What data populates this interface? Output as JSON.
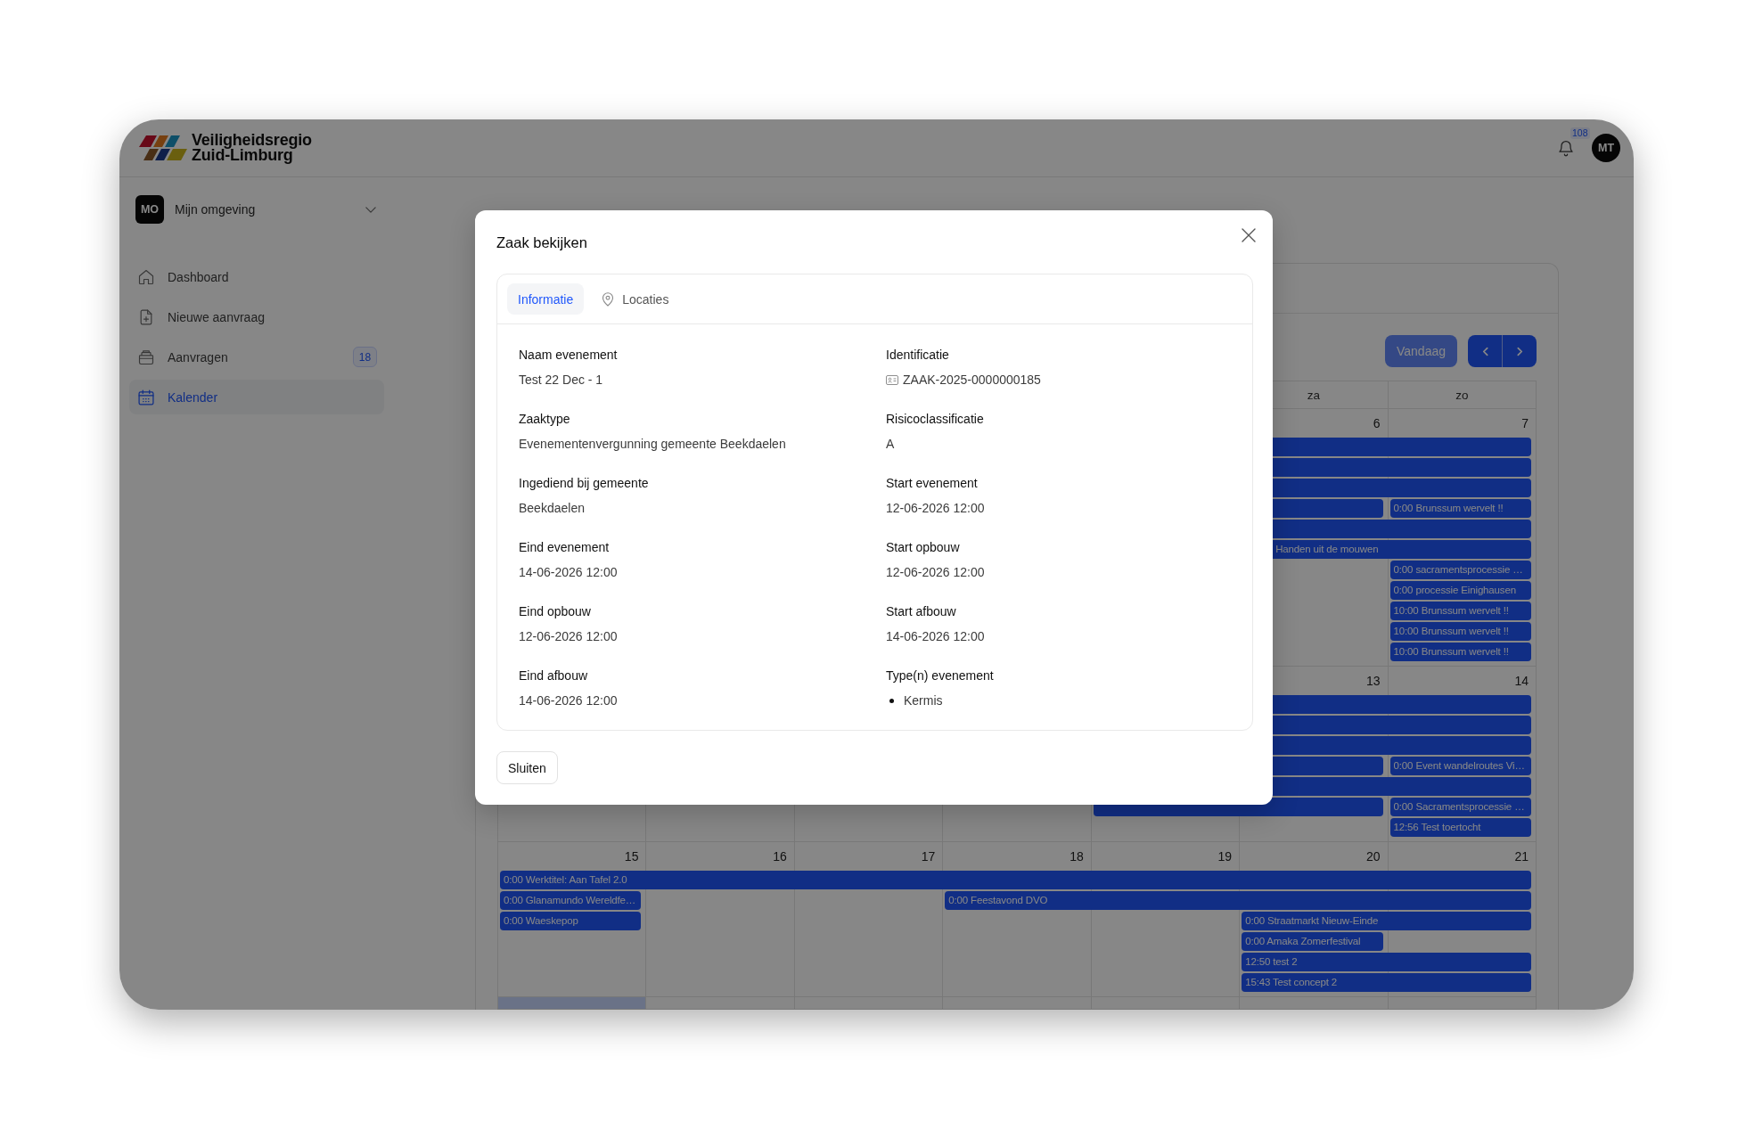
{
  "header": {
    "brand_lines": [
      "Veiligheidsregio",
      "Zuid-Limburg"
    ],
    "notification_count": "108",
    "user_initials": "MT"
  },
  "workspace": {
    "initials": "MO",
    "name": "Mijn omgeving"
  },
  "sidebar": {
    "items": [
      {
        "kind": "home",
        "label": "Dashboard",
        "selected": false
      },
      {
        "kind": "new",
        "label": "Nieuwe aanvraag",
        "selected": false
      },
      {
        "kind": "requests",
        "label": "Aanvragen",
        "badge": "18",
        "selected": false
      },
      {
        "kind": "calendar",
        "label": "Kalender",
        "selected": true
      }
    ]
  },
  "calendar": {
    "today_button": {
      "label": "Vandaag",
      "disabled": true
    },
    "weekday_headers": [
      "za",
      "zo"
    ],
    "weeks": [
      {
        "days": [
          {
            "number": "6",
            "today": false
          },
          {
            "number": "7",
            "today": false
          }
        ],
        "lanes": [
          [
            {
              "kind": "continued"
            },
            {
              "kind": "more"
            }
          ],
          [
            {
              "kind": "continued"
            },
            {
              "kind": "more"
            }
          ],
          [
            {
              "kind": "continued"
            },
            {
              "kind": "more"
            }
          ],
          [
            {
              "kind": "continued"
            },
            {
              "kind": "event",
              "title": "0:00 Brunssum wervelt !!"
            }
          ],
          [
            {
              "kind": "continued"
            },
            {
              "kind": "more"
            }
          ],
          [
            {
              "kind": "continued",
              "title": "Handen uit de mouwen"
            },
            {
              "kind": "more"
            }
          ],
          [
            {
              "kind": "event",
              "title": "0:00 sacramentsprocessie …"
            }
          ],
          [
            {
              "kind": "event",
              "title": "0:00 processie Einighausen"
            }
          ],
          [
            {
              "kind": "event",
              "title": "10:00 Brunssum wervelt !!"
            }
          ],
          [
            {
              "kind": "event",
              "title": "10:00 Brunssum wervelt !!"
            }
          ],
          [
            {
              "kind": "event",
              "title": "10:00 Brunssum wervelt !!"
            }
          ]
        ]
      },
      {
        "days": [
          {
            "today": false
          },
          {
            "today": false
          },
          {
            "today": false
          },
          {
            "today": false
          },
          {
            "today": false
          },
          {
            "number": "13",
            "today": false
          },
          {
            "number": "14",
            "today": false
          }
        ],
        "lanes": [
          [
            {
              "kind": "continued"
            },
            {
              "kind": "more"
            }
          ],
          [
            {
              "kind": "continued"
            },
            {
              "kind": "more"
            }
          ],
          [
            {
              "kind": "continued"
            },
            {
              "kind": "more"
            }
          ],
          [
            {
              "kind": "continued"
            },
            {
              "kind": "event",
              "title": "0:00 Event wandelroutes Vi…"
            }
          ],
          [
            {
              "kind": "continued"
            },
            {
              "kind": "more"
            }
          ],
          [
            {
              "kind": "event"
            },
            {
              "kind": "more"
            },
            {
              "kind": "event",
              "title": "0:00 Sacramentsprocessie …"
            }
          ],
          [
            {
              "kind": "event",
              "title": "12:56 Test toertocht"
            }
          ]
        ]
      },
      {
        "days": [
          {
            "number": "15",
            "today": false
          },
          {
            "number": "16",
            "today": false
          },
          {
            "number": "17",
            "today": false
          },
          {
            "number": "18",
            "today": false
          },
          {
            "number": "19",
            "today": false
          },
          {
            "number": "20",
            "today": false
          },
          {
            "number": "21",
            "today": false
          }
        ],
        "lanes": [
          [
            {
              "kind": "event",
              "title": "0:00 Werktitel: Aan Tafel 2.0"
            },
            {
              "kind": "more"
            },
            {
              "kind": "more"
            },
            {
              "kind": "more"
            },
            {
              "kind": "more"
            },
            {
              "kind": "more"
            },
            {
              "kind": "more"
            }
          ],
          [
            {
              "kind": "event",
              "title": "0:00 Glanamundo Wereldfe…"
            },
            {
              "kind": "empty"
            },
            {
              "kind": "empty"
            },
            {
              "kind": "event",
              "title": "0:00 Feestavond DVO"
            },
            {
              "kind": "more"
            },
            {
              "kind": "more"
            },
            {
              "kind": "more"
            }
          ],
          [
            {
              "kind": "event",
              "title": "0:00 Waeskepop"
            },
            {
              "kind": "empty"
            },
            {
              "kind": "empty"
            },
            {
              "kind": "empty"
            },
            {
              "kind": "empty"
            },
            {
              "kind": "event",
              "title": "0:00 Straatmarkt Nieuw-Einde"
            },
            {
              "kind": "more"
            }
          ],
          [
            {
              "kind": "event",
              "title": "0:00 Amaka Zomerfestival"
            },
            {
              "kind": "empty"
            }
          ],
          [
            {
              "kind": "event",
              "title": "12:50 test 2"
            },
            {
              "kind": "more"
            }
          ],
          [
            {
              "kind": "event",
              "title": "15:43 Test concept 2"
            },
            {
              "kind": "more"
            }
          ]
        ]
      },
      {
        "days": [
          {
            "today": true
          },
          {
            "today": false
          },
          {
            "today": false
          },
          {
            "today": false
          },
          {
            "today": false
          },
          {
            "today": false
          },
          {
            "today": false
          }
        ]
      }
    ]
  },
  "modal": {
    "title": "Zaak bekijken",
    "tabs": [
      {
        "kind": "info",
        "label": "Informatie",
        "selected": true
      },
      {
        "kind": "location",
        "label": "Locaties",
        "selected": false
      }
    ],
    "fields": [
      {
        "kind": "text",
        "label": "Naam evenement",
        "value": "Test 22 Dec - 1"
      },
      {
        "kind": "id",
        "label": "Identificatie",
        "value": "ZAAK-2025-0000000185"
      },
      {
        "kind": "text",
        "label": "Zaaktype",
        "value": "Evenementenvergunning gemeente Beekdaelen"
      },
      {
        "kind": "text",
        "label": "Risicoclassificatie",
        "value": "A"
      },
      {
        "kind": "text",
        "label": "Ingediend bij gemeente",
        "value": "Beekdaelen"
      },
      {
        "kind": "text",
        "label": "Start evenement",
        "value": "12-06-2026 12:00"
      },
      {
        "kind": "text",
        "label": "Eind evenement",
        "value": "14-06-2026 12:00"
      },
      {
        "kind": "text",
        "label": "Start opbouw",
        "value": "12-06-2026 12:00"
      },
      {
        "kind": "text",
        "label": "Eind opbouw",
        "value": "12-06-2026 12:00"
      },
      {
        "kind": "text",
        "label": "Start afbouw",
        "value": "14-06-2026 12:00"
      },
      {
        "kind": "text",
        "label": "Eind afbouw",
        "value": "14-06-2026 12:00"
      },
      {
        "kind": "list",
        "label": "Type(n) evenement",
        "values": [
          "Kermis"
        ]
      }
    ],
    "close_button": "Sluiten"
  }
}
